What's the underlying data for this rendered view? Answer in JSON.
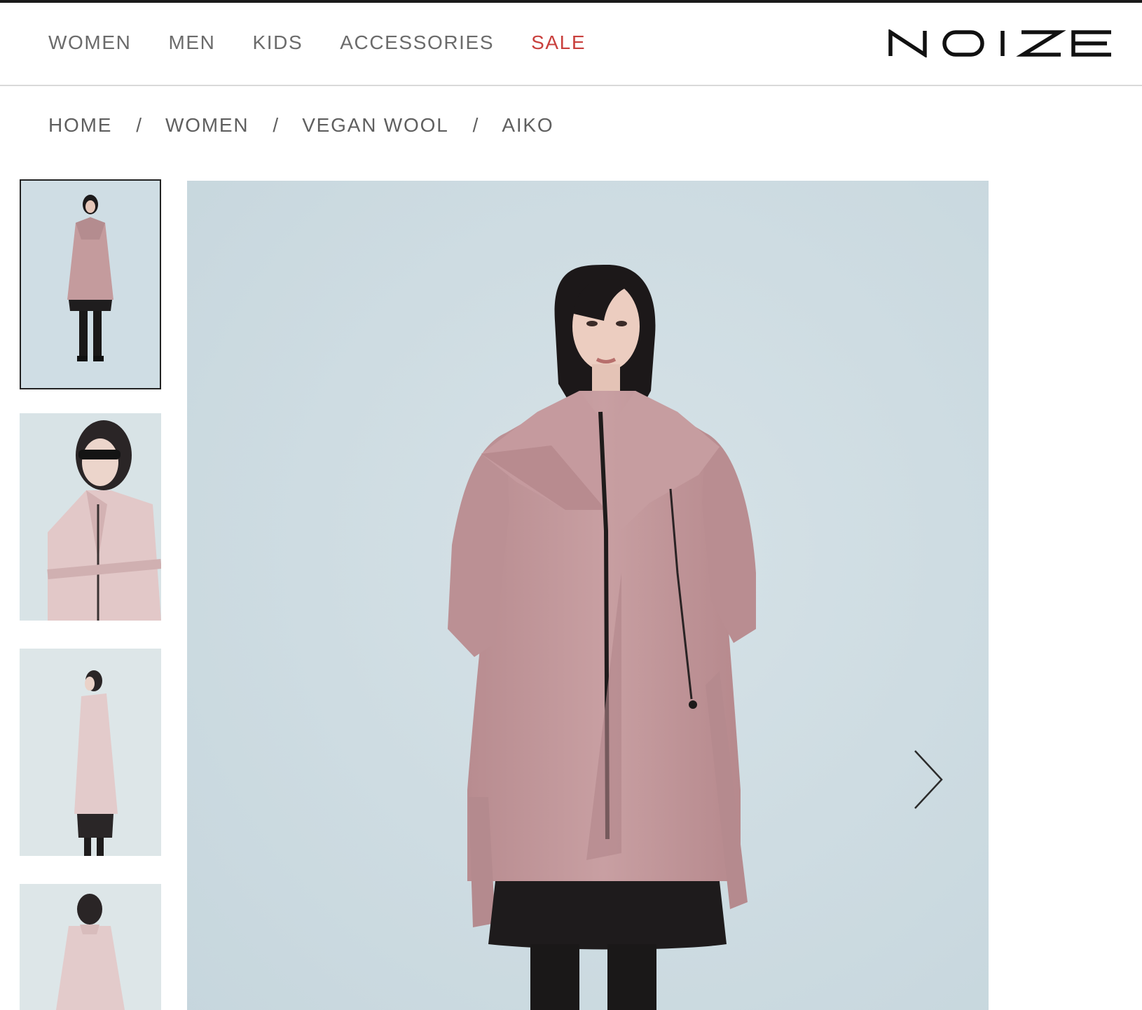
{
  "nav": {
    "items": [
      {
        "label": "WOMEN"
      },
      {
        "label": "MEN"
      },
      {
        "label": "KIDS"
      },
      {
        "label": "ACCESSORIES"
      },
      {
        "label": "SALE"
      }
    ],
    "sale_color": "#c9403d"
  },
  "brand": {
    "logo_text": "NOIZE"
  },
  "breadcrumb": {
    "items": [
      {
        "label": "HOME"
      },
      {
        "label": "WOMEN"
      },
      {
        "label": "VEGAN WOOL"
      },
      {
        "label": "AIKO"
      }
    ],
    "separator": "/"
  },
  "gallery": {
    "active_thumbnail": 1,
    "thumbnail_count": 4,
    "next_icon": "chevron-right-icon",
    "background_color": "#cfdde3",
    "coat_color": "#c79c9f"
  }
}
